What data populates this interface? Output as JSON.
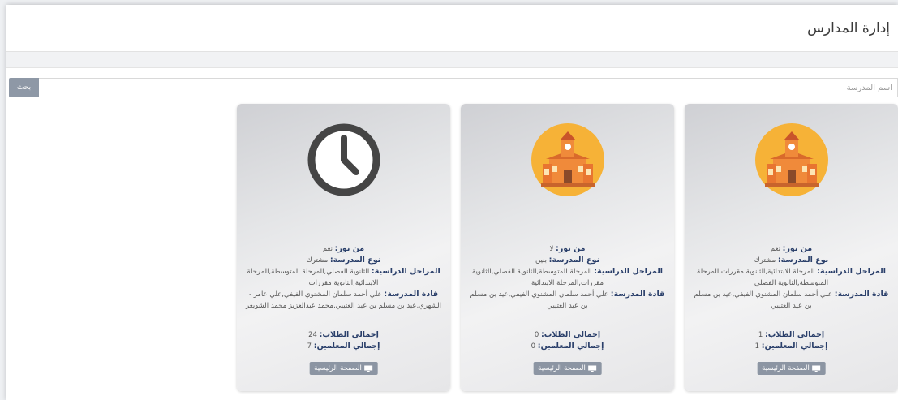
{
  "page": {
    "title": "إدارة المدارس"
  },
  "search": {
    "placeholder": "اسم المدرسة",
    "button_label": "بحث"
  },
  "labels": {
    "noor": "من نور:",
    "type": "نوع المدرسة:",
    "stages": "المراحل الدراسية:",
    "leaders": "قادة المدرسة:",
    "students": "إجمالي الطلاب:",
    "teachers": "إجمالي المعلمين:",
    "home_button": "الصفحة الرئيسية"
  },
  "schools": [
    {
      "icon": "school-building-icon",
      "noor": "نعم",
      "type": "مشترك",
      "stages": "المرحلة الابتدائية,الثانوية مقررات,المرحلة المتوسطة,الثانوية الفصلي",
      "leaders": "علي أحمد سلمان المشنوي الفيفي,عيد بن مسلم بن عيد العتيبي",
      "students": "1",
      "teachers": "1"
    },
    {
      "icon": "school-building-icon",
      "noor": "لا",
      "type": "بنين",
      "stages": "المرحلة المتوسطة,الثانوية الفصلي,الثانوية مقررات,المرحلة الابتدائية",
      "leaders": "علي أحمد سلمان المشنوي الفيفي,عيد بن مسلم بن عيد العتيبي",
      "students": "0",
      "teachers": "0"
    },
    {
      "icon": "clock-icon",
      "noor": "نعم",
      "type": "مشترك",
      "stages": "الثانوية الفصلي,المرحلة المتوسطة,المرحلة الابتدائية,الثانوية مقررات",
      "leaders": "علي أحمد سلمان المشنوي الفيفي,علي عامر - الشهري,عيد بن مسلم بن عيد العتيبي,محمد عبدالعزيز محمد الشويعر",
      "students": "24",
      "teachers": "7"
    }
  ]
}
